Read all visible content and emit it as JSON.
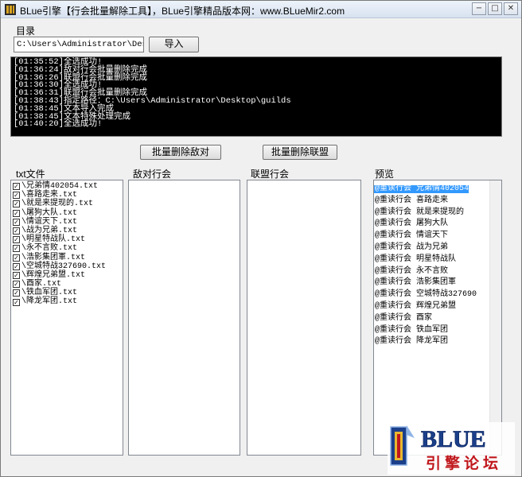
{
  "window": {
    "title": "BLue引擎【行会批量解除工具】，BLue引擎精品版本网：www.BLueMir2.com",
    "buttons": {
      "minimize": "−",
      "restore": "□",
      "close": "✕"
    }
  },
  "dir": {
    "label": "目录",
    "path_value": "C:\\Users\\Administrator\\Desktop\\gu",
    "import_label": "导入"
  },
  "log": [
    "[01:35:52]全选成功!",
    "[01:36:24]敌对行会批量删除完成",
    "[01:36:26]联盟行会批量删除完成",
    "[01:36:30]全选成功!",
    "[01:36:31]联盟行会批量删除完成",
    "[01:38:43]指定路径：C:\\Users\\Administrator\\Desktop\\guilds",
    "[01:38:45]文本导入完成",
    "[01:38:45]文本特殊处理完成",
    "[01:40:20]全选成功!"
  ],
  "actions": {
    "delete_enemy": "批量删除敌对",
    "delete_alliance": "批量删除联盟"
  },
  "columns": {
    "txt_files": "txt文件",
    "enemy_guilds": "敌对行会",
    "alliance_guilds": "联盟行会",
    "preview": "预览"
  },
  "files": [
    "\\兄弟情402054.txt",
    "\\喜路走来.txt",
    "\\就是来提现的.txt",
    "\\屠狗大队.txt",
    "\\情谊天下.txt",
    "\\战为兄弟.txt",
    "\\明星特战队.txt",
    "\\永不言败.txt",
    "\\浩影集团軍.txt",
    "\\空城特战327690.txt",
    "\\辉煌兄弟盟.txt",
    "\\酉家.txt",
    "\\铁血军团.txt",
    "\\降龙军团.txt"
  ],
  "preview": [
    "@重读行会 兄弟情402054",
    "@重读行会 喜路走来",
    "@重读行会 就是来提现的",
    "@重读行会 屠狗大队",
    "@重读行会 情谊天下",
    "@重读行会 战为兄弟",
    "@重读行会 明星特战队",
    "@重读行会 永不言败",
    "@重读行会 浩影集团軍",
    "@重读行会 空城特战327690",
    "@重读行会 辉煌兄弟盟",
    "@重读行会 酉家",
    "@重读行会 铁血军团",
    "@重读行会 降龙军团"
  ],
  "logo": {
    "brand": "BLUE",
    "subtitle": "引擎论坛"
  },
  "colors": {
    "selection": "#3399ff",
    "log_bg": "#000000",
    "logo_blue": "#1b3f8a",
    "logo_red": "#c0171c"
  }
}
